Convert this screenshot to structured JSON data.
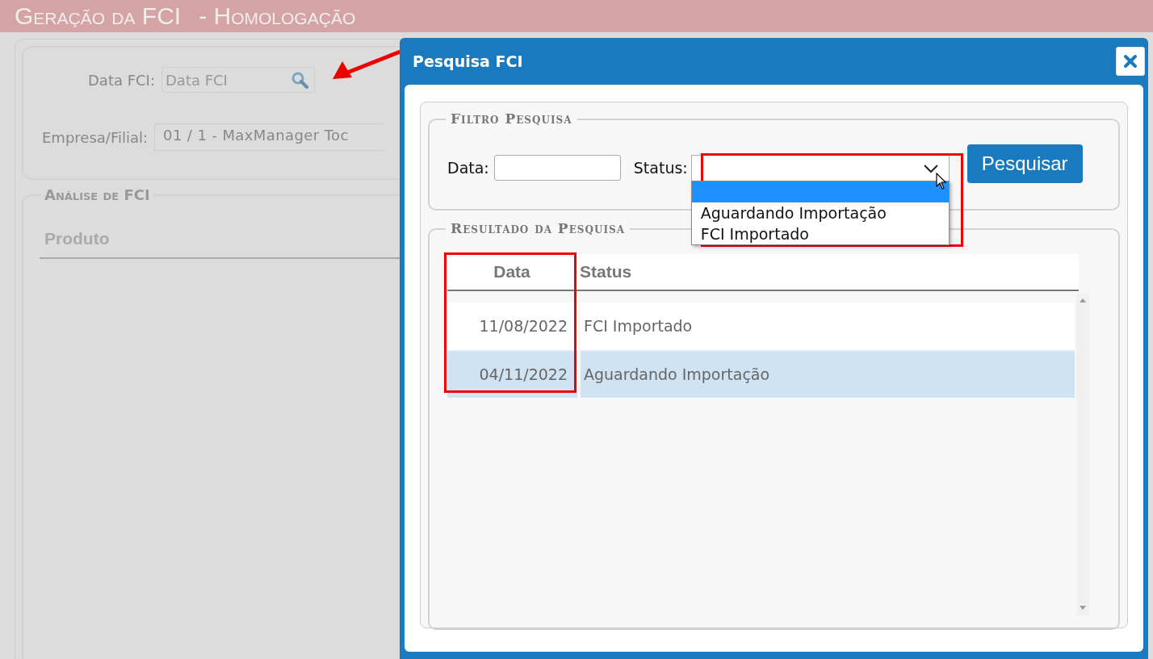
{
  "page": {
    "title": "Geração da FCI",
    "environment": "- Homologação"
  },
  "filters": {
    "date_label": "Data FCI:",
    "date_placeholder": "Data FCI",
    "company_label": "Empresa/Filial:",
    "company_value": "01 / 1 - MaxManager Toc"
  },
  "analysis": {
    "legend": "Análise de FCI",
    "columns": [
      "Produto"
    ]
  },
  "dialog": {
    "title": "Pesquisa FCI",
    "filter": {
      "legend": "Filtro Pesquisa",
      "date_label": "Data:",
      "status_label": "Status:",
      "expanded": true,
      "status_options": [
        {
          "selected": true
        },
        {
          "label": "Aguardando Importação",
          "selected": false
        },
        {
          "label": "FCI Importado",
          "selected": false
        }
      ],
      "search_button": "Pesquisar"
    },
    "results": {
      "legend": "Resultado da Pesquisa",
      "columns": [
        "Data",
        "Status"
      ],
      "rows": [
        {
          "date": "11/08/2022",
          "status": "FCI Importado",
          "selected": false
        },
        {
          "date": "04/11/2022",
          "status": "Aguardando Importação",
          "selected": true
        }
      ]
    }
  }
}
